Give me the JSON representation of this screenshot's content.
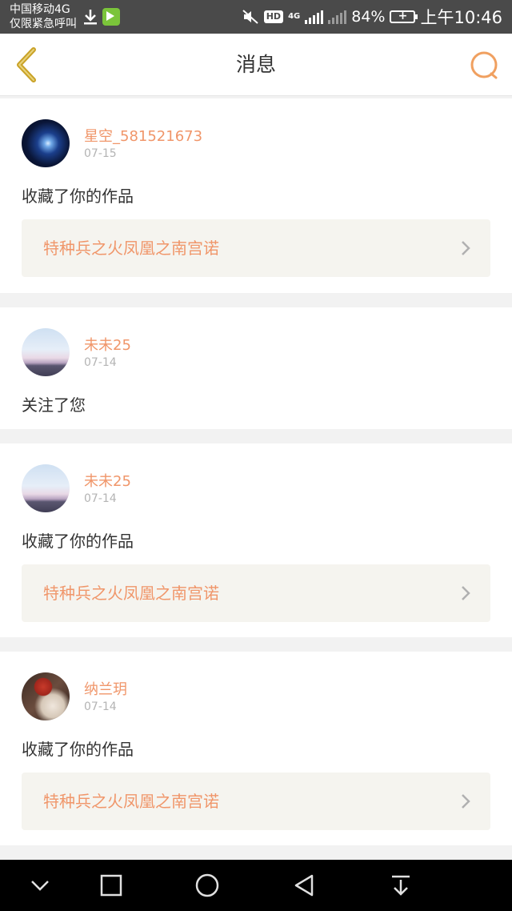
{
  "status_bar": {
    "carrier": "中国移动4G",
    "emergency": "仅限紧急呼叫",
    "hd": "HD",
    "net_type": "4G",
    "battery_pct": "84%",
    "time": "上午10:46"
  },
  "header": {
    "title": "消息",
    "back_icon": "chevron-left-icon",
    "search_icon": "search-icon"
  },
  "messages": [
    {
      "user": "星空_581521673",
      "date": "07-15",
      "action": "收藏了你的作品",
      "work": "特种兵之火凤凰之南宫诺"
    },
    {
      "user": "未未25",
      "date": "07-14",
      "action": "关注了您"
    },
    {
      "user": "未未25",
      "date": "07-14",
      "action": "收藏了你的作品",
      "work": "特种兵之火凤凰之南宫诺"
    },
    {
      "user": "纳兰玥",
      "date": "07-14",
      "action": "收藏了你的作品",
      "work": "特种兵之火凤凰之南宫诺"
    }
  ],
  "colors": {
    "accent": "#f0966a",
    "back_icon": "#c9a227",
    "search_icon": "#f0a060",
    "work_bg": "#f5f4ef",
    "page_bg": "#f2f2f2"
  },
  "nav_bar": {
    "icons": [
      "chevron-down-icon",
      "square-icon",
      "circle-icon",
      "triangle-back-icon",
      "pull-down-icon"
    ]
  }
}
